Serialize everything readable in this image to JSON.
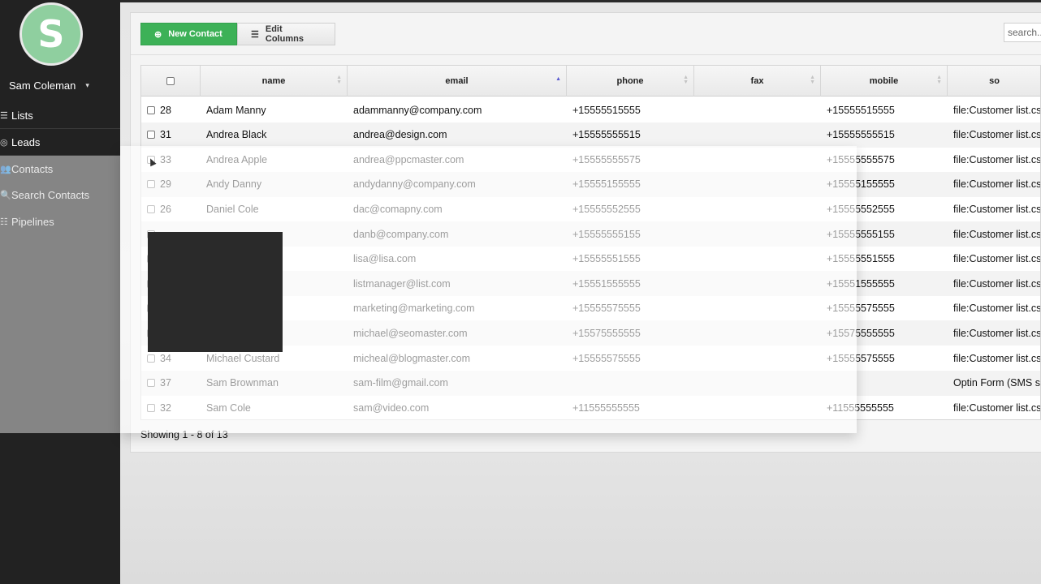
{
  "user": {
    "initial": "S",
    "name": "Sam Coleman",
    "caret": "▾"
  },
  "nav": [
    {
      "label": "Lists",
      "icon": "list-icon",
      "glyph": "☰"
    },
    {
      "label": "Leads",
      "icon": "target-icon",
      "glyph": "◎"
    },
    {
      "label": "Contacts",
      "icon": "people-icon",
      "glyph": "👥"
    },
    {
      "label": "Search Contacts",
      "icon": "search-icon",
      "glyph": "🔍"
    },
    {
      "label": "Pipelines",
      "icon": "filter-icon",
      "glyph": "☷"
    }
  ],
  "toolbar": {
    "new_contact_label": "New Contact",
    "new_contact_glyph": "⊕",
    "edit_columns_label": "Edit Columns",
    "edit_columns_glyph": "☰",
    "search_placeholder": "search..."
  },
  "table": {
    "columns": [
      "name",
      "email",
      "phone",
      "fax",
      "mobile",
      "so"
    ],
    "sorted_column": "email",
    "rows": [
      {
        "id": "28",
        "name": "Adam Manny",
        "email": "adammanny@company.com",
        "phone": "+15555515555",
        "fax": "",
        "mobile": "+15555515555",
        "source": "file:Customer list.csv"
      },
      {
        "id": "31",
        "name": "Andrea Black",
        "email": "andrea@design.com",
        "phone": "+15555555515",
        "fax": "",
        "mobile": "+15555555515",
        "source": "file:Customer list.csv"
      },
      {
        "id": "33",
        "name": "Andrea Apple",
        "email": "andrea@ppcmaster.com",
        "phone": "+15555555575",
        "fax": "",
        "mobile": "+15555555575",
        "source": "file:Customer list.csv"
      },
      {
        "id": "29",
        "name": "Andy Danny",
        "email": "andydanny@company.com",
        "phone": "+15555155555",
        "fax": "",
        "mobile": "+15555155555",
        "source": "file:Customer list.csv"
      },
      {
        "id": "26",
        "name": "Daniel Cole",
        "email": "dac@comapny.com",
        "phone": "+15555552555",
        "fax": "",
        "mobile": "+15555552555",
        "source": "file:Customer list.csv"
      },
      {
        "id": "",
        "name": "",
        "email": "danb@company.com",
        "phone": "+15555555155",
        "fax": "",
        "mobile": "+15555555155",
        "source": "file:Customer list.csv"
      },
      {
        "id": "",
        "name": "",
        "email": "lisa@lisa.com",
        "phone": "+15555551555",
        "fax": "",
        "mobile": "+15555551555",
        "source": "file:Customer list.csv"
      },
      {
        "id": "",
        "name": "",
        "email": "listmanager@list.com",
        "phone": "+15551555555",
        "fax": "",
        "mobile": "+15551555555",
        "source": "file:Customer list.csv"
      },
      {
        "id": "",
        "name": "",
        "email": "marketing@marketing.com",
        "phone": "+15555575555",
        "fax": "",
        "mobile": "+15555575555",
        "source": "file:Customer list.csv"
      },
      {
        "id": "",
        "name": "",
        "email": "michael@seomaster.com",
        "phone": "+15575555555",
        "fax": "",
        "mobile": "+15575555555",
        "source": "file:Customer list.csv"
      },
      {
        "id": "34",
        "name": "Michael Custard",
        "email": "micheal@blogmaster.com",
        "phone": "+15555575555",
        "fax": "",
        "mobile": "+15555575555",
        "source": "file:Customer list.csv"
      },
      {
        "id": "37",
        "name": "Sam Brownman",
        "email": "sam-film@gmail.com",
        "phone": "",
        "fax": "",
        "mobile": "",
        "source": "Optin Form (SMS si"
      },
      {
        "id": "32",
        "name": "Sam Cole",
        "email": "sam@video.com",
        "phone": "+11555555555",
        "fax": "",
        "mobile": "+11555555555",
        "source": "file:Customer list.csv"
      }
    ]
  },
  "footer": {
    "showing": "Showing 1 - 8 of 13"
  },
  "colors": {
    "accent_green": "#3db157",
    "sidebar_bg": "#222222",
    "avatar_bg": "#8fcf9f"
  }
}
